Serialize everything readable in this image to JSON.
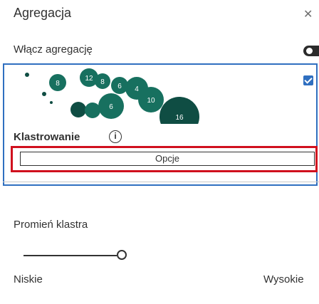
{
  "panel": {
    "title": "Agregacja",
    "close_icon": "close-icon"
  },
  "aggregation": {
    "toggle_label": "Włącz agregację",
    "enabled": true
  },
  "clustering_card": {
    "label": "Klastrowanie",
    "info_icon": "info-icon",
    "selected": true,
    "thumbnail_cluster_labels": [
      "8",
      "12",
      "6",
      "4",
      "10",
      "6",
      "8",
      "16"
    ],
    "options_button_label": "Opcje"
  },
  "cluster_radius": {
    "label": "Promień klastra",
    "min_label": "Niskie",
    "max_label": "Wysokie"
  },
  "colors": {
    "accent": "#2f6fc0",
    "highlight": "#d0101e",
    "cluster_fill": "#17705f",
    "cluster_fill_dark": "#0f4d43"
  }
}
